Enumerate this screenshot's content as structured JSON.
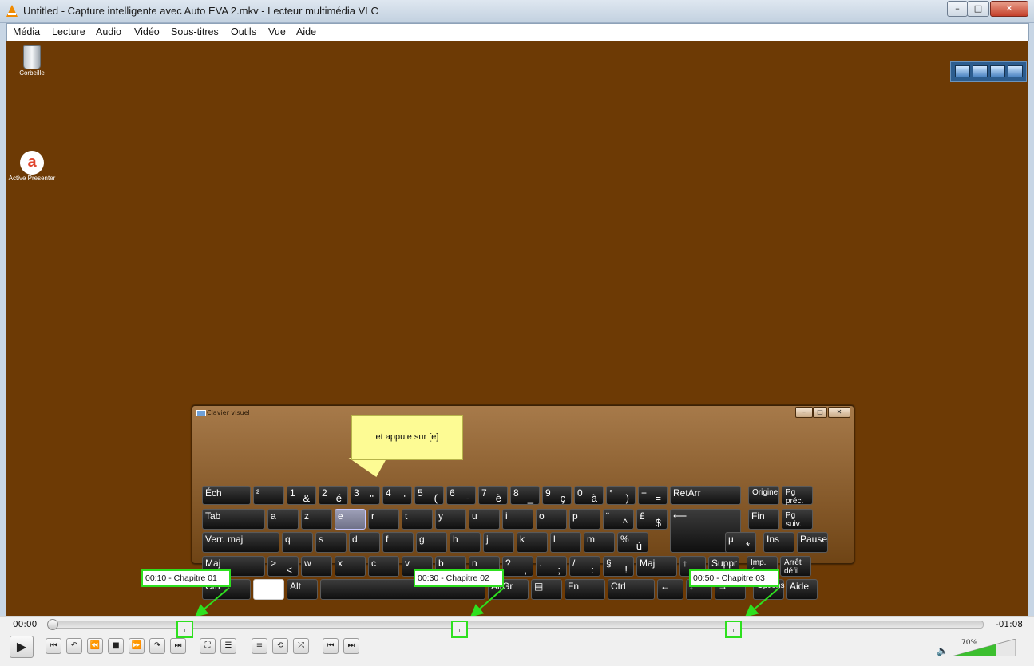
{
  "window": {
    "title": "Untitled - Capture intelligente avec Auto EVA 2.mkv - Lecteur multimédia VLC",
    "min_glyph": "–",
    "max_glyph": "□",
    "close_glyph": "✕"
  },
  "menu": [
    "Média",
    "Lecture",
    "Audio",
    "Vidéo",
    "Sous-titres",
    "Outils",
    "Vue",
    "Aide"
  ],
  "desktop": {
    "recycle_label": "Corbeille",
    "activepresenter_label": "Active Presenter"
  },
  "osk": {
    "title": "Clavier visuel",
    "win_min": "–",
    "win_max": "□",
    "win_close": "✕",
    "rows": [
      [
        {
          "t": "Éch"
        },
        {
          "t": "²"
        },
        {
          "t": "1",
          "b": "&"
        },
        {
          "t": "2",
          "b": "é"
        },
        {
          "t": "3",
          "b": "\""
        },
        {
          "t": "4",
          "b": "'"
        },
        {
          "t": "5",
          "b": "("
        },
        {
          "t": "6",
          "b": "-"
        },
        {
          "t": "7",
          "b": "è"
        },
        {
          "t": "8",
          "b": "_"
        },
        {
          "t": "9",
          "b": "ç"
        },
        {
          "t": "0",
          "b": "à"
        },
        {
          "t": "°",
          "b": ")"
        },
        {
          "t": "+",
          "b": "="
        },
        {
          "t": "RetArr"
        },
        {
          "t": "Origine",
          "small": true
        },
        {
          "t": "Pg préc.",
          "small": true
        }
      ],
      [
        {
          "t": "Tab"
        },
        {
          "t": "a"
        },
        {
          "t": "z"
        },
        {
          "t": "e",
          "hl": true
        },
        {
          "t": "r"
        },
        {
          "t": "t"
        },
        {
          "t": "y"
        },
        {
          "t": "u"
        },
        {
          "t": "i"
        },
        {
          "t": "o"
        },
        {
          "t": "p"
        },
        {
          "t": "¨",
          "b": "^"
        },
        {
          "t": "£",
          "b": "$"
        },
        {
          "t": "⟵"
        },
        {
          "t": "Fin"
        },
        {
          "t": "Pg suiv.",
          "small": true
        }
      ],
      [
        {
          "t": "Verr. maj"
        },
        {
          "t": "q"
        },
        {
          "t": "s"
        },
        {
          "t": "d"
        },
        {
          "t": "f"
        },
        {
          "t": "g"
        },
        {
          "t": "h"
        },
        {
          "t": "j"
        },
        {
          "t": "k"
        },
        {
          "t": "l"
        },
        {
          "t": "m"
        },
        {
          "t": "%",
          "b": "ù"
        },
        {
          "t": "µ",
          "b": "*"
        },
        {
          "t": "Ins"
        },
        {
          "t": "Pause"
        }
      ],
      [
        {
          "t": "Maj"
        },
        {
          "t": ">",
          "b": "<"
        },
        {
          "t": "w"
        },
        {
          "t": "x"
        },
        {
          "t": "c"
        },
        {
          "t": "v"
        },
        {
          "t": "b"
        },
        {
          "t": "n"
        },
        {
          "t": "?",
          "b": ","
        },
        {
          "t": ".",
          "b": ";"
        },
        {
          "t": "/",
          "b": ":"
        },
        {
          "t": "§",
          "b": "!"
        },
        {
          "t": "Maj"
        },
        {
          "t": "↑"
        },
        {
          "t": "Suppr"
        },
        {
          "t": "Imp. écr.",
          "small": true
        },
        {
          "t": "Arrêt défil",
          "small": true
        }
      ],
      [
        {
          "t": "Ctrl"
        },
        {
          "t": "",
          "white": true
        },
        {
          "t": "Alt"
        },
        {
          "t": ""
        },
        {
          "t": "AltGr"
        },
        {
          "t": "▤"
        },
        {
          "t": "Fn"
        },
        {
          "t": "Ctrl"
        },
        {
          "t": "←"
        },
        {
          "t": "↓"
        },
        {
          "t": "→"
        },
        {
          "t": "Options",
          "small": true
        },
        {
          "t": "Aide"
        }
      ]
    ]
  },
  "callout": {
    "text": "et appuie sur [e]"
  },
  "chapters": [
    {
      "label": "00:10 -  Chapitre 01"
    },
    {
      "label": "00:30 -  Chapitre 02"
    },
    {
      "label": "00:50 -  Chapitre 03"
    }
  ],
  "player": {
    "time_elapsed": "00:00",
    "time_remaining": "-01:08",
    "volume": "70%",
    "volume_level": 0.7,
    "seek_position": 0.0,
    "buttons": [
      "play-icon",
      "prev-icon",
      "loop-back-icon",
      "rewind-icon",
      "stop-icon",
      "forward-icon",
      "loop-forward-icon",
      "next-icon",
      "fullscreen-icon",
      "equalizer-icon",
      "playlist-icon",
      "loop-icon",
      "shuffle-icon",
      "frame-prev-icon",
      "frame-next-icon"
    ]
  }
}
